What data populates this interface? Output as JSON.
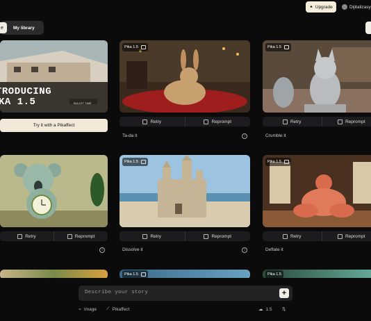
{
  "header": {
    "upgrade_label": "Upgrade",
    "user_name": "Dijitalizasy"
  },
  "tabs": {
    "first_label": "e",
    "library_label": "My library"
  },
  "intro_card": {
    "title_line1": "TRODUCING",
    "title_line2": "KA 1.5",
    "sign_text": "BULLET TIME",
    "cta_label": "Try it with a Pikaffect"
  },
  "cards": [
    {
      "badge": "Pika 1.5",
      "caption": "Ta-da it",
      "retry": "Retry",
      "reprompt": "Reprompt"
    },
    {
      "badge": "Pika 1.5",
      "caption": "Crumble it",
      "retry": "Retry",
      "reprompt": "Reprompt"
    },
    {
      "badge": "",
      "caption": "",
      "retry": "Retry",
      "reprompt": "Reprompt"
    },
    {
      "badge": "Pika 1.5",
      "caption": "Dissolve it",
      "retry": "Retry",
      "reprompt": "Reprompt"
    },
    {
      "badge": "Pika 1.5",
      "caption": "Deflate it",
      "retry": "Retry",
      "reprompt": "Reprompt"
    },
    {
      "badge": "Pika 1.5"
    },
    {
      "badge": "Pika 1.5"
    }
  ],
  "composer": {
    "placeholder": "Describe your story",
    "image_label": "Image",
    "pikaffect_label": "Pikaffect",
    "credits": "1.5"
  },
  "icons": [
    "sparkle-icon",
    "image-icon",
    "retry-icon",
    "reprompt-icon",
    "info-icon",
    "plus-icon",
    "paperclip-icon",
    "wand-icon",
    "cloud-icon",
    "settings-sliders-icon"
  ]
}
